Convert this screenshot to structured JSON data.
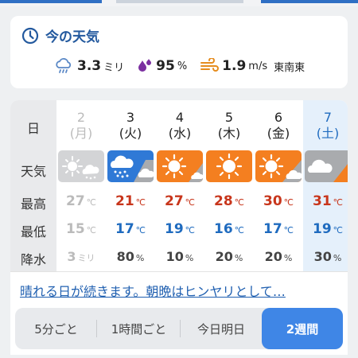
{
  "current": {
    "title": "今の天気",
    "precip_value": "3.3",
    "precip_unit": "ミリ",
    "humidity_value": "95",
    "humidity_unit": "%",
    "wind_value": "1.9",
    "wind_unit": "m/s",
    "wind_dir": "東南東"
  },
  "forecast": {
    "labels": {
      "day": "日",
      "weather": "天気",
      "high": "最高",
      "low": "最低",
      "rain": "降水"
    },
    "days": [
      {
        "day": "2",
        "weekday": "(月)",
        "weather_icon": "sun-rain-icon",
        "high": "27",
        "high_unit": "℃",
        "low": "15",
        "low_unit": "℃",
        "rain": "3",
        "rain_unit": "ミリ",
        "past": true
      },
      {
        "day": "3",
        "weekday": "(火)",
        "weather_icon": "rain-then-cloud-icon",
        "high": "21",
        "high_unit": "℃",
        "low": "17",
        "low_unit": "℃",
        "rain": "80",
        "rain_unit": "%"
      },
      {
        "day": "4",
        "weekday": "(水)",
        "weather_icon": "sun-then-cloud-icon",
        "high": "27",
        "high_unit": "℃",
        "low": "19",
        "low_unit": "℃",
        "rain": "10",
        "rain_unit": "%"
      },
      {
        "day": "5",
        "weekday": "(木)",
        "weather_icon": "sun-icon",
        "high": "28",
        "high_unit": "℃",
        "low": "16",
        "low_unit": "℃",
        "rain": "20",
        "rain_unit": "%"
      },
      {
        "day": "6",
        "weekday": "(金)",
        "weather_icon": "sun-then-cloud-icon",
        "high": "30",
        "high_unit": "℃",
        "low": "17",
        "low_unit": "℃",
        "rain": "20",
        "rain_unit": "%"
      },
      {
        "day": "7",
        "weekday": "(土)",
        "weather_icon": "cloud-then-sun-icon",
        "high": "31",
        "high_unit": "℃",
        "low": "19",
        "low_unit": "℃",
        "rain": "30",
        "rain_unit": "%"
      }
    ]
  },
  "summary": "晴れる日が続きます。朝晩はヒンヤリとして…",
  "tabs": [
    {
      "label": "5分ごと",
      "active": false
    },
    {
      "label": "1時間ごと",
      "active": false
    },
    {
      "label": "今日明日",
      "active": false
    },
    {
      "label": "2週間",
      "active": true
    }
  ],
  "colors": {
    "sunny": "#f47f20",
    "rain": "#2f79d6",
    "cloud": "#a9abae",
    "past": "#d3d4d6",
    "accent": "#3f86e6"
  }
}
